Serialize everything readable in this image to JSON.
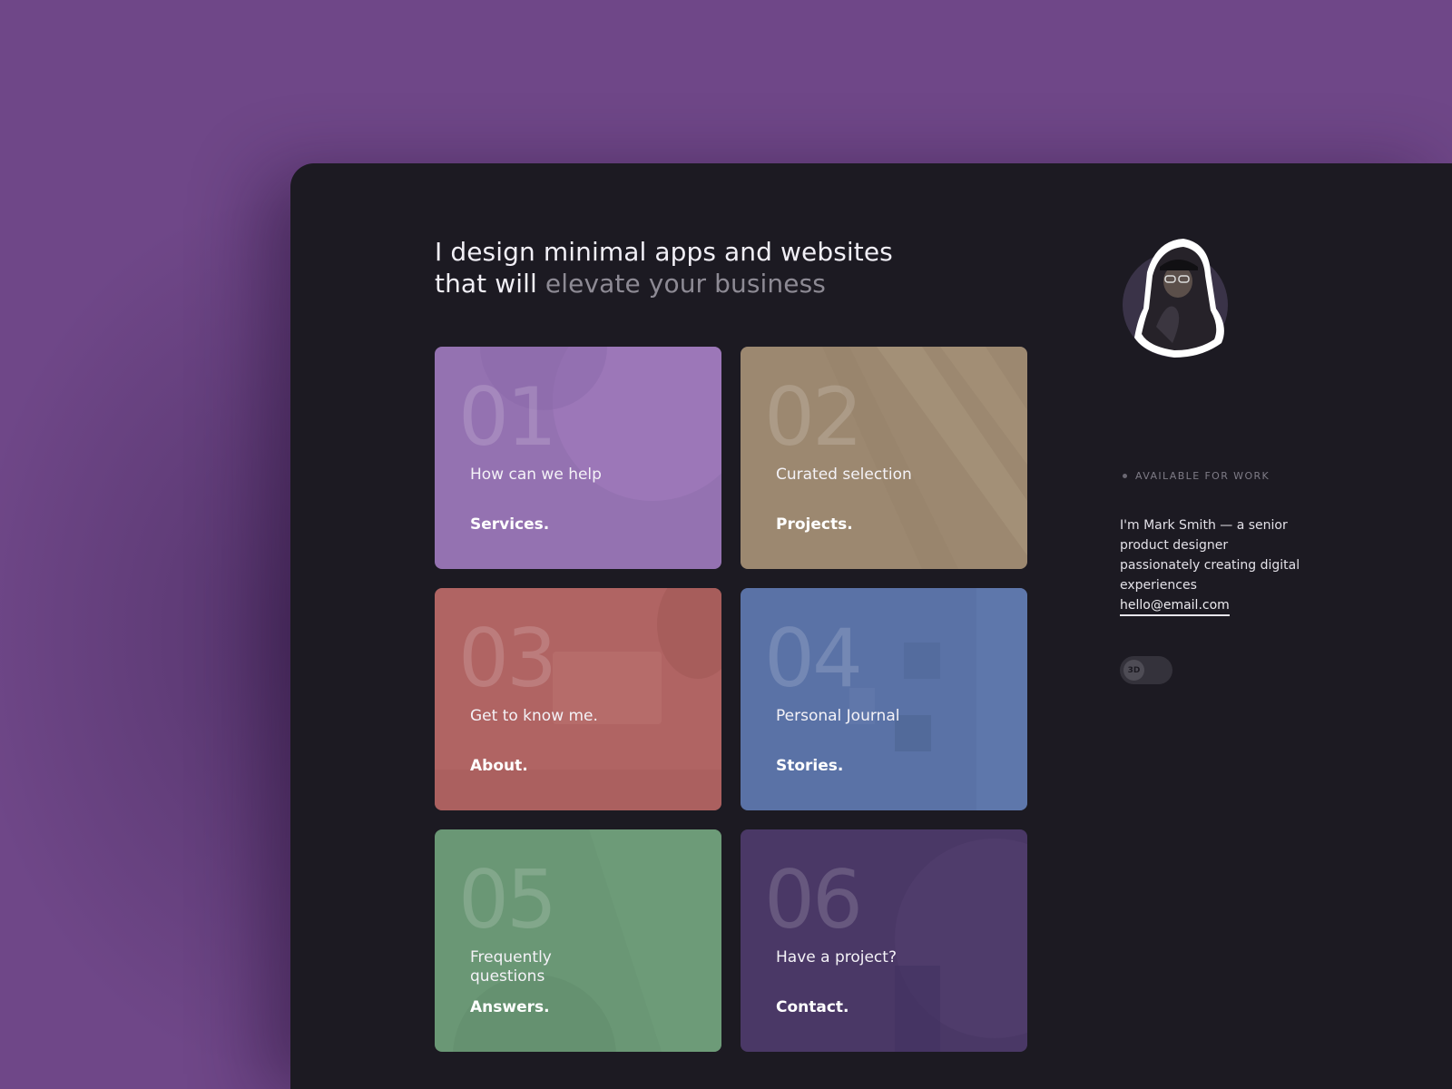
{
  "headline": {
    "line1": "I design minimal apps and websites",
    "line2_plain": "that will",
    "line2_muted": "elevate your business"
  },
  "cards": [
    {
      "number": "01",
      "subtitle": "How can we help",
      "title": "Services.",
      "color": "#9472b1"
    },
    {
      "number": "02",
      "subtitle": "Curated selection",
      "title": "Projects.",
      "color": "#9c8870"
    },
    {
      "number": "03",
      "subtitle": "Get to know me.",
      "title": "About.",
      "color": "#b06463"
    },
    {
      "number": "04",
      "subtitle": "Personal Journal",
      "title": "Stories.",
      "color": "#5a72a6"
    },
    {
      "number": "05",
      "subtitle": "Frequently questions",
      "title": "Answers.",
      "color": "#6a9775"
    },
    {
      "number": "06",
      "subtitle": "Have a project?",
      "title": "Contact.",
      "color": "#4a3866"
    }
  ],
  "sidebar": {
    "status": "AVAILABLE FOR WORK",
    "bio": "I'm Mark Smith — a senior product designer passionately creating digital experiences",
    "email": "hello@email.com",
    "toggle_label": "3D"
  },
  "colors": {
    "background": "#6f4788",
    "panel": "#1c1a22",
    "text_muted": "#8d8a94"
  }
}
